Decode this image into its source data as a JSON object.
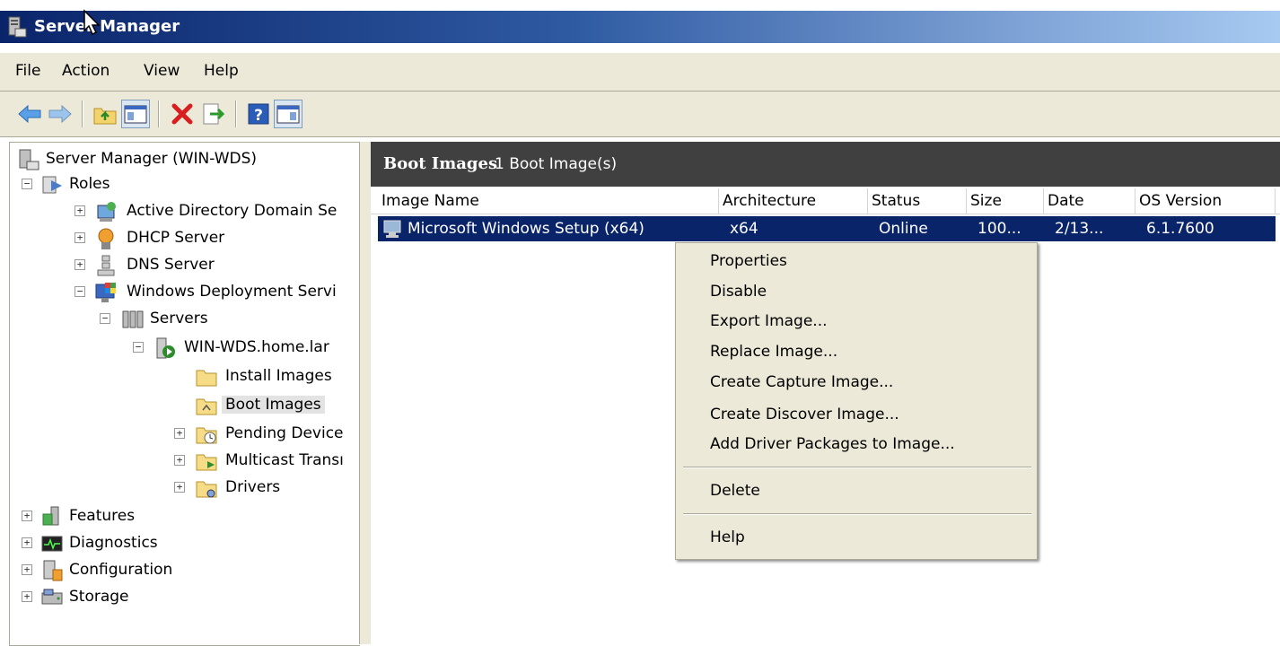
{
  "window": {
    "title": "Server Manager"
  },
  "menubar": {
    "items": [
      "File",
      "Action",
      "View",
      "Help"
    ]
  },
  "toolbar": {
    "buttons": [
      "back-arrow-icon",
      "forward-arrow-icon",
      "up-folder-icon",
      "show-hide-tree-icon",
      "delete-icon",
      "export-list-icon",
      "help-icon",
      "show-hide-action-pane-icon"
    ]
  },
  "tree": {
    "root": "Server Manager (WIN-WDS)",
    "roles": "Roles",
    "ad": "Active Directory Domain Se",
    "dhcp": "DHCP Server",
    "dns": "DNS Server",
    "wds": "Windows Deployment Servi",
    "servers": "Servers",
    "server": "WIN-WDS.home.lar",
    "install_images": "Install Images",
    "boot_images": "Boot Images",
    "pending": "Pending Device",
    "multicast": "Multicast Transı",
    "drivers": "Drivers",
    "features": "Features",
    "diagnostics": "Diagnostics",
    "configuration": "Configuration",
    "storage": "Storage"
  },
  "pane": {
    "title": "Boot Images",
    "count": "1 Boot Image(s)",
    "columns": [
      "Image Name",
      "Architecture",
      "Status",
      "Size",
      "Date",
      "OS Version"
    ],
    "rows": [
      {
        "name": "Microsoft Windows Setup (x64)",
        "arch": "x64",
        "status": "Online",
        "size": "100...",
        "date": "2/13...",
        "os": "6.1.7600"
      }
    ]
  },
  "context_menu": {
    "items": [
      "Properties",
      "Disable",
      "Export Image...",
      "Replace Image...",
      "Create Capture Image...",
      "Create Discover Image...",
      "Add Driver Packages to Image...",
      "Delete",
      "Help"
    ]
  },
  "colors": {
    "titlebar": "#0a246a",
    "selection": "#0a246a",
    "pane_header": "#404040",
    "chrome": "#ece9d8"
  }
}
